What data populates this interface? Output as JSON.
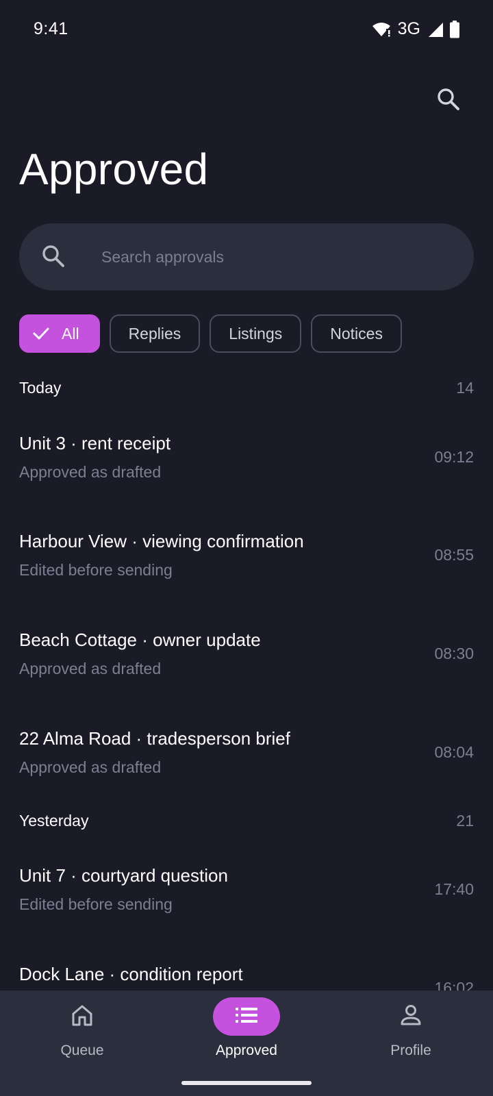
{
  "status_bar": {
    "time": "9:41",
    "network": "3G"
  },
  "header": {
    "title": "Approved"
  },
  "search": {
    "placeholder": "Search approvals"
  },
  "filters": [
    {
      "label": "All",
      "selected": true
    },
    {
      "label": "Replies",
      "selected": false
    },
    {
      "label": "Listings",
      "selected": false
    },
    {
      "label": "Notices",
      "selected": false
    }
  ],
  "sections": [
    {
      "title": "Today",
      "count": "14",
      "items": [
        {
          "title": "Unit 3 · rent receipt",
          "subtitle": "Approved as drafted",
          "time": "09:12"
        },
        {
          "title": "Harbour View · viewing confirmation",
          "subtitle": "Edited before sending",
          "time": "08:55"
        },
        {
          "title": "Beach Cottage · owner update",
          "subtitle": "Approved as drafted",
          "time": "08:30"
        },
        {
          "title": "22 Alma Road · tradesperson brief",
          "subtitle": "Approved as drafted",
          "time": "08:04"
        }
      ]
    },
    {
      "title": "Yesterday",
      "count": "21",
      "items": [
        {
          "title": "Unit 7 · courtyard question",
          "subtitle": "Edited before sending",
          "time": "17:40"
        },
        {
          "title": "Dock Lane · condition report",
          "subtitle": "",
          "time": "16:02"
        }
      ]
    }
  ],
  "bottom_nav": [
    {
      "label": "Queue",
      "icon": "home-icon",
      "active": false
    },
    {
      "label": "Approved",
      "icon": "list-icon",
      "active": true
    },
    {
      "label": "Profile",
      "icon": "person-icon",
      "active": false
    }
  ],
  "colors": {
    "background": "#1a1b26",
    "surface": "#2b2e3d",
    "accent": "#c552df",
    "muted_text": "#7a7f92"
  }
}
